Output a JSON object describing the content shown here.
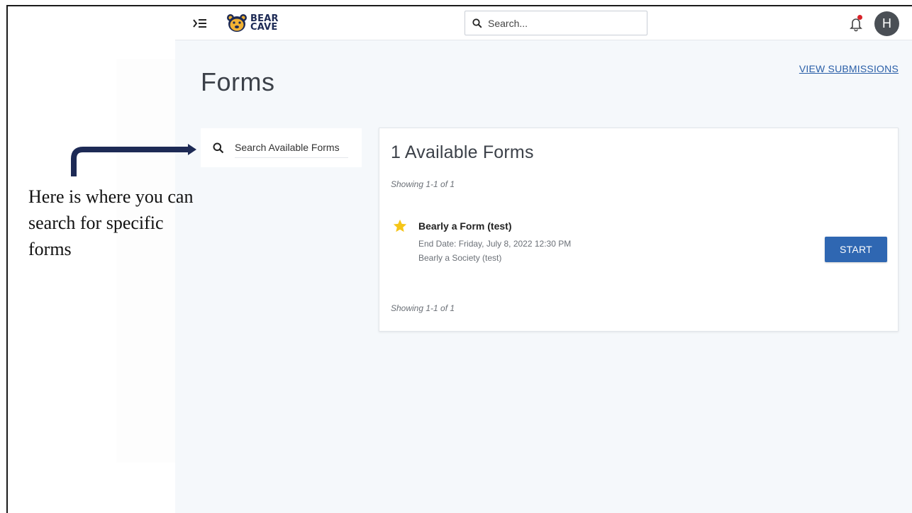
{
  "topbar": {
    "logo_line1": "BEAR",
    "logo_line2": "CAVE",
    "search_placeholder": "Search...",
    "avatar_initial": "H"
  },
  "page": {
    "title": "Forms",
    "view_submissions": "VIEW SUBMISSIONS",
    "search_forms_placeholder": "Search Available Forms"
  },
  "card": {
    "title": "1 Available Forms",
    "showing_top": "Showing 1-1 of 1",
    "showing_bottom": "Showing 1-1 of 1",
    "form": {
      "name": "Bearly a Form (test)",
      "end_date": "End Date: Friday, July 8, 2022 12:30 PM",
      "organization": "Bearly a Society (test)",
      "start_label": "START"
    }
  },
  "annotation": {
    "text": "Here is where you can search for specific forms"
  },
  "colors": {
    "brand_navy": "#1d2a55",
    "primary_button": "#2f67b2",
    "link": "#2a5fa8",
    "star": "#f5c518",
    "notification_dot": "#d8232a"
  }
}
